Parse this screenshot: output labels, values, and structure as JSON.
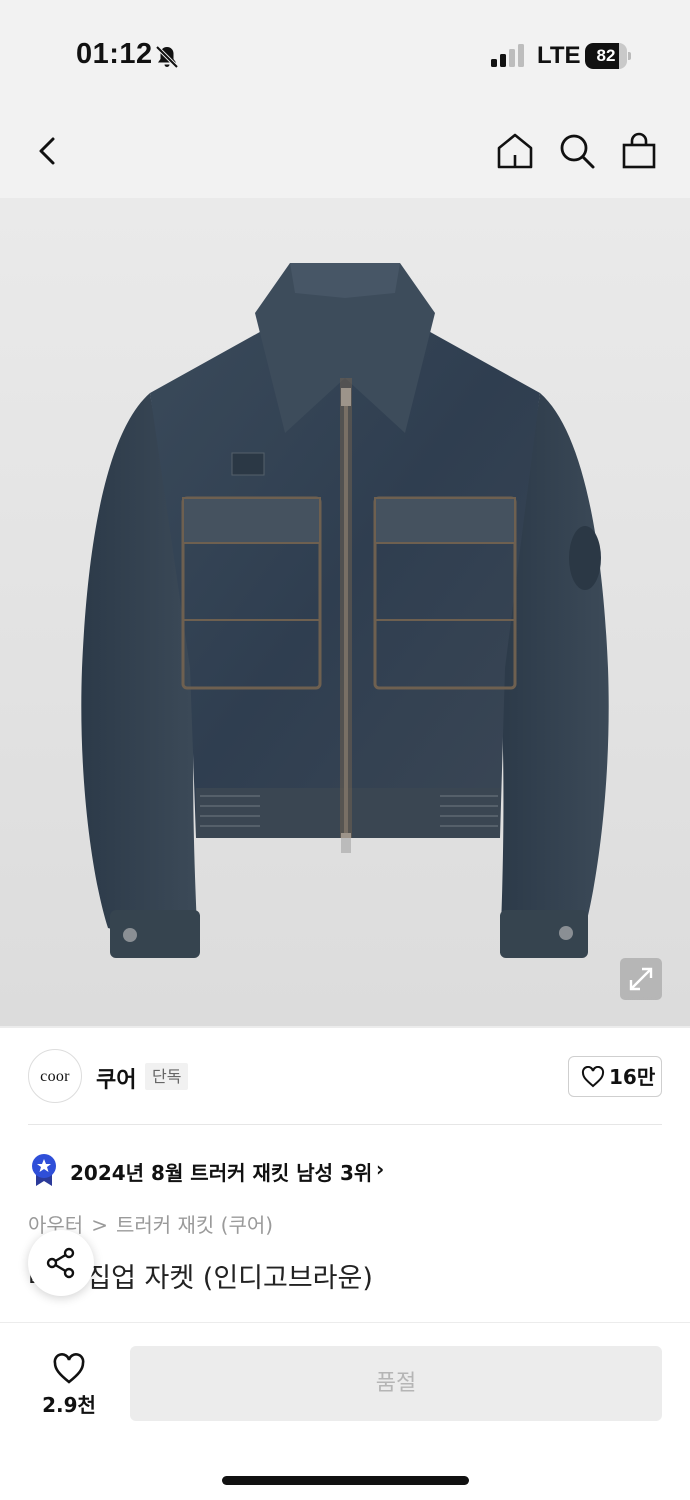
{
  "status_bar": {
    "time": "01:12",
    "network": "LTE",
    "battery_percent": "82",
    "battery_level": 0.82
  },
  "nav": {
    "back_icon": "chevron-left-icon",
    "home_icon": "home-icon",
    "search_icon": "search-icon",
    "cart_icon": "shopping-bag-icon"
  },
  "product_image": {
    "expand_icon": "expand-icon"
  },
  "brand": {
    "logo_text": "coor",
    "name": "쿠어",
    "badge": "단독",
    "like_count": "16만"
  },
  "ranking": {
    "text": "2024년 8월 트러커 재킷 남성 3위",
    "chevron": "›"
  },
  "breadcrumb": {
    "items": [
      "아우터",
      "트러커 재킷 (쿠어)"
    ],
    "separator": ">"
  },
  "product": {
    "title": "데님 집업 자켓 (인디고브라운)"
  },
  "bottom": {
    "wish_count": "2.9천",
    "soldout_label": "품절"
  },
  "colors": {
    "accent_blue": "#2f4fd8",
    "soldout_bg": "#ececec",
    "soldout_text": "#b5b5b5"
  }
}
